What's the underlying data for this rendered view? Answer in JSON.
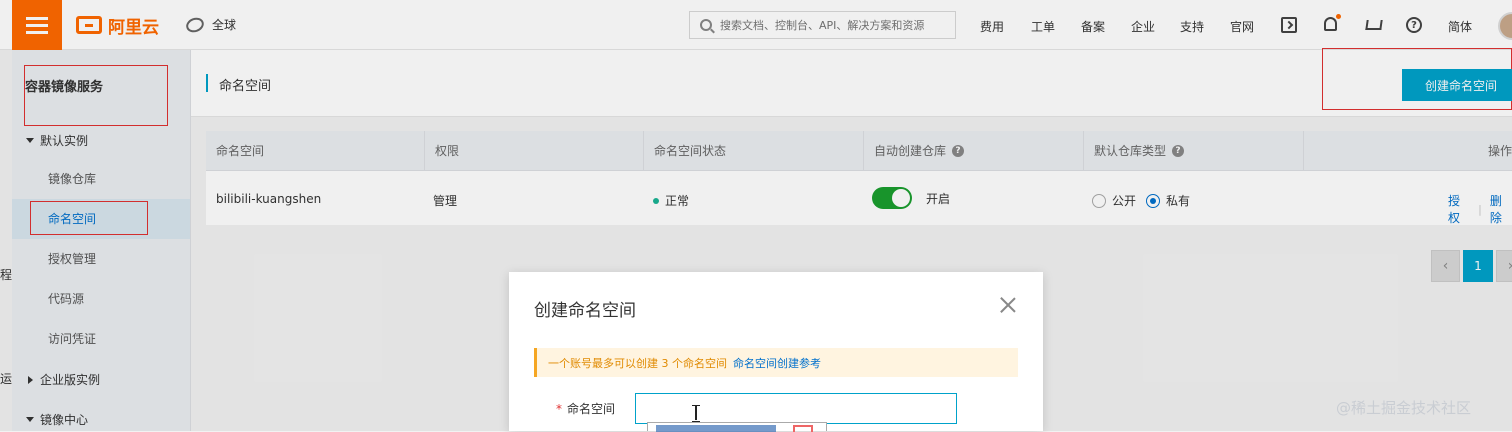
{
  "topbar": {
    "logo_text": "阿里云",
    "region": "全球",
    "search_placeholder": "搜索文档、控制台、API、解决方案和资源",
    "nav": [
      "费用",
      "工单",
      "备案",
      "企业",
      "支持",
      "官网"
    ],
    "language": "简体"
  },
  "sidebar": {
    "title": "容器镜像服务",
    "group_default": "默认实例",
    "items": [
      "镜像仓库",
      "命名空间",
      "授权管理",
      "代码源",
      "访问凭证"
    ],
    "active_index": 1,
    "group_enterprise": "企业版实例",
    "group_mirror": "镜像中心"
  },
  "content": {
    "page_title": "命名空间",
    "create_button": "创建命名空间"
  },
  "table": {
    "columns": [
      "命名空间",
      "权限",
      "命名空间状态",
      "自动创建仓库",
      "默认仓库类型",
      "操作"
    ],
    "rows": [
      {
        "namespace": "bilibili-kuangshen",
        "permission": "管理",
        "status": "正常",
        "auto_create": "开启",
        "auto_create_on": true,
        "type_public": "公开",
        "type_private": "私有",
        "selected_type": "私有",
        "action_authorize": "授权",
        "action_delete": "删除"
      }
    ]
  },
  "pagination": {
    "current_page": "1"
  },
  "modal": {
    "title": "创建命名空间",
    "tip_warning": "一个账号最多可以创建 3 个命名空间",
    "tip_link": "命名空间创建参考",
    "field_required_mark": "*",
    "field_label": "命名空间",
    "field_value": ""
  },
  "left_fragments": [
    "程",
    "运"
  ],
  "watermark": "@稀土掘金技术社区",
  "colors": {
    "brand_orange": "#ff6a00",
    "accent_blue": "#00a2ca",
    "link_blue": "#0070cc",
    "success_green": "#1a9e2e",
    "highlight_red": "#e03131"
  }
}
